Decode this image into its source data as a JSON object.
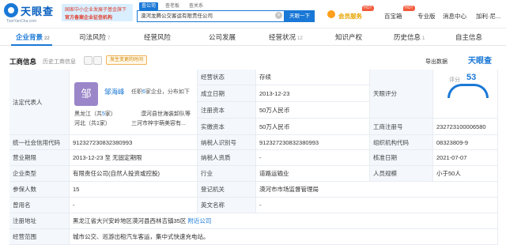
{
  "header": {
    "logo_text": "天眼查",
    "logo_url": "TianYanCha.com",
    "banner_line1": "国家中小企业发展子基金旗下",
    "banner_line2": "官方备案企业征信机构",
    "search_tabs": [
      "查公司",
      "查老板",
      "查关系"
    ],
    "search_value": "漠河龙腾公交客运有限责任公司",
    "search_clear": "×",
    "search_button": "天眼一下",
    "vip_label": "会员服务",
    "nav": [
      "百宝箱",
      "专业版",
      "消息中心",
      "加利·尼..."
    ],
    "hot_badge": "HOT"
  },
  "tabs": [
    {
      "label": "企业背景",
      "count": "22"
    },
    {
      "label": "司法风险",
      "count": "7"
    },
    {
      "label": "经营风险",
      "count": ""
    },
    {
      "label": "公司发展",
      "count": ""
    },
    {
      "label": "经营状况",
      "count": "12"
    },
    {
      "label": "知识产权",
      "count": ""
    },
    {
      "label": "历史信息",
      "count": "1"
    },
    {
      "label": "自主信息",
      "count": ""
    }
  ],
  "section": {
    "title": "工商信息",
    "history": "历史工商信息",
    "warning": "发生变更的时间",
    "export": "导出数据",
    "brand": "天眼查"
  },
  "legal": {
    "label": "法定代表人",
    "avatar_char": "邹",
    "name": "邹海峰",
    "role_prefix": "任职",
    "role_count": "6",
    "role_suffix": "家企业，分布如下",
    "rel1": "黑龙江（共",
    "rel1_n": "5",
    "rel1_end": "家）",
    "rel2": "漠河县世海装卸队等",
    "rel3": "河北（共1家）",
    "rel4": "三河市梓宇萌美容有..."
  },
  "fields": {
    "status_label": "经营状态",
    "status_value": "存续",
    "founded_label": "成立日期",
    "founded_value": "2013-12-23",
    "capital_label": "注册资本",
    "capital_value": "50万人民币",
    "paid_label": "实缴资本",
    "paid_value": "50万人民币",
    "score_label": "天眼评分",
    "score_title": "评分",
    "score_value": "53",
    "regno_label": "工商注册号",
    "regno_value": "232723100006580",
    "credit_label": "统一社会信用代码",
    "credit_value": "91232723083238099З",
    "taxid_label": "纳税人识别号",
    "taxid_value": "912327230832380993",
    "orgcode_label": "组织机构代码",
    "orgcode_value": "08323809-9",
    "term_label": "营业期限",
    "term_value": "2013-12-23 至 无固定期限",
    "taxq_label": "纳税人资质",
    "taxq_value": "-",
    "approve_label": "核准日期",
    "approve_value": "2021-07-07",
    "type_label": "企业类型",
    "type_value": "有限责任公司(自然人投资或控股)",
    "industry_label": "行业",
    "industry_value": "道路运输业",
    "staff_label": "人员规模",
    "staff_value": "小于50人",
    "insured_label": "参保人数",
    "insured_value": "15",
    "authority_label": "登记机关",
    "authority_value": "漠河市市场监督管理局",
    "former_label": "曾用名",
    "former_value": "-",
    "english_label": "英文名称",
    "english_value": "-",
    "address_label": "注册地址",
    "address_value": "黑龙江省大兴安岭地区漠河县西林吉镇35区",
    "address_link": "附近公司",
    "scope_label": "经营范围",
    "scope_value": "城市公交、巡游出租汽车客运，集中式快速充电站。"
  }
}
